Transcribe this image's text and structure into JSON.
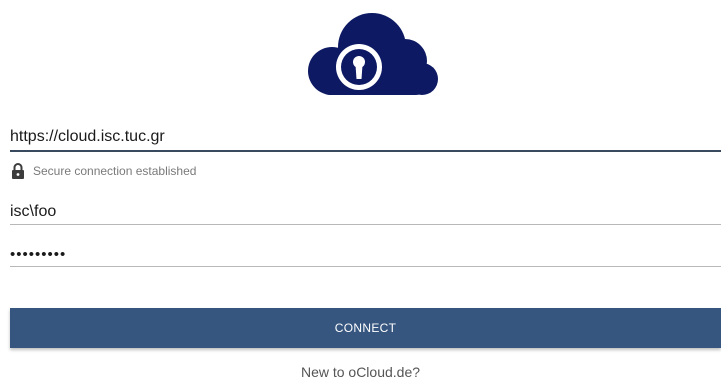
{
  "logo": {
    "icon": "cloud-keyhole-logo",
    "color": "#0d1a63"
  },
  "server": {
    "url_value": "https://cloud.isc.tuc.gr",
    "status_text": "Secure connection established",
    "status_icon": "lock-icon"
  },
  "username": {
    "value": "isc\\foo"
  },
  "password": {
    "value": "secretpw1"
  },
  "connect_label": "CONNECT",
  "signup_link": "New to oCloud.de?",
  "colors": {
    "accent": "#36557f",
    "logo": "#0d1a63",
    "secondary_text": "#7a7a7a"
  }
}
